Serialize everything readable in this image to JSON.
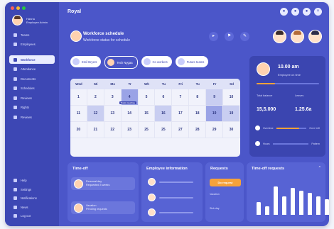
{
  "colors": {
    "primary": "#4b56c9",
    "sidebar": "#3d47b4",
    "accent": "#f6a23a",
    "calendar_bg": "#f1f2fb"
  },
  "window": {
    "controls": [
      "#ff5f57",
      "#febc2e",
      "#28c840"
    ]
  },
  "sidebar": {
    "user_name": "Hanna",
    "user_role": "Employee Admin",
    "items": [
      {
        "label": "Teams",
        "icon": "people-icon"
      },
      {
        "label": "Employees",
        "icon": "person-icon"
      },
      {
        "label": "Workforce",
        "icon": "calendar-icon",
        "active": true
      },
      {
        "label": "Attendance",
        "icon": "clock-icon"
      },
      {
        "label": "Documents",
        "icon": "doc-icon"
      },
      {
        "label": "Schedules",
        "icon": "schedule-icon"
      },
      {
        "label": "Reviews",
        "icon": "star-icon"
      },
      {
        "label": "Rights",
        "icon": "shield-icon"
      },
      {
        "label": "Reviews",
        "icon": "chart-icon"
      }
    ],
    "bottom_items": [
      {
        "label": "Help",
        "icon": "help-icon"
      },
      {
        "label": "Settings",
        "icon": "gear-icon"
      },
      {
        "label": "Notifications",
        "icon": "bell-icon"
      },
      {
        "label": "News",
        "icon": "news-icon"
      },
      {
        "label": "Log out",
        "icon": "logout-icon"
      }
    ]
  },
  "header": {
    "title": "Royal",
    "icons": [
      "bell-icon",
      "settings-icon",
      "user-icon",
      "close-icon"
    ]
  },
  "hero": {
    "title": "Workforce schedule",
    "subtitle": "Workforce status for schedule",
    "action_icons": [
      "play-icon",
      "flag-icon",
      "edit-icon"
    ]
  },
  "tabs": [
    {
      "label": "Emil Bryers",
      "style": "light"
    },
    {
      "label": "Tech Nygaa",
      "style": "dark"
    },
    {
      "label": "Co workers",
      "style": "light"
    },
    {
      "label": "Future teams",
      "style": "light"
    }
  ],
  "calendar": {
    "days": [
      "Wed",
      "Mi",
      "Mo",
      "Tr",
      "Wh",
      "Tu",
      "Fri",
      "Tu",
      "Fr",
      "Sd"
    ],
    "rows": [
      [
        "1",
        "2",
        "3",
        "4",
        "5",
        "6",
        "7",
        "8",
        "9",
        "10"
      ],
      [
        "11",
        "12",
        "13",
        "14",
        "15",
        "16",
        "17",
        "18",
        "19",
        "19"
      ],
      [
        "20",
        "21",
        "22",
        "23",
        "25",
        "25",
        "27",
        "28",
        "29",
        "30"
      ]
    ],
    "event_label": "Team meeting"
  },
  "clock_card": {
    "time": "10.00 am",
    "subtitle": "Employee on time",
    "progress": 0.3,
    "stat1_label": "Total balance",
    "stat1_value": "15,5.000",
    "stat2_label": "Leaves",
    "stat2_value": "1.25.6a",
    "row1_label": "Overtime",
    "row1_value": "Over 140",
    "row1_progress": 0.75,
    "row2_label": "Hours",
    "row2_value": "Pattern"
  },
  "timeoff": {
    "title": "Time-off",
    "rows": [
      {
        "name": "Personal day",
        "sub": "Requested 3 weeks"
      },
      {
        "name": "Vacation",
        "sub": "Pending requests"
      }
    ]
  },
  "employee_info": {
    "title": "Employee information"
  },
  "requests": {
    "title": "Requests",
    "button": "Do request",
    "rows": [
      "Vacation",
      "Sick day"
    ]
  },
  "timeoff_requests": {
    "title": "Time-off requests",
    "more_icon": "caret-up-icon"
  },
  "chart_data": {
    "type": "bar",
    "values": [
      18,
      12,
      40,
      26,
      38,
      34,
      31,
      26,
      22,
      20
    ],
    "ylim": [
      0,
      48
    ]
  }
}
